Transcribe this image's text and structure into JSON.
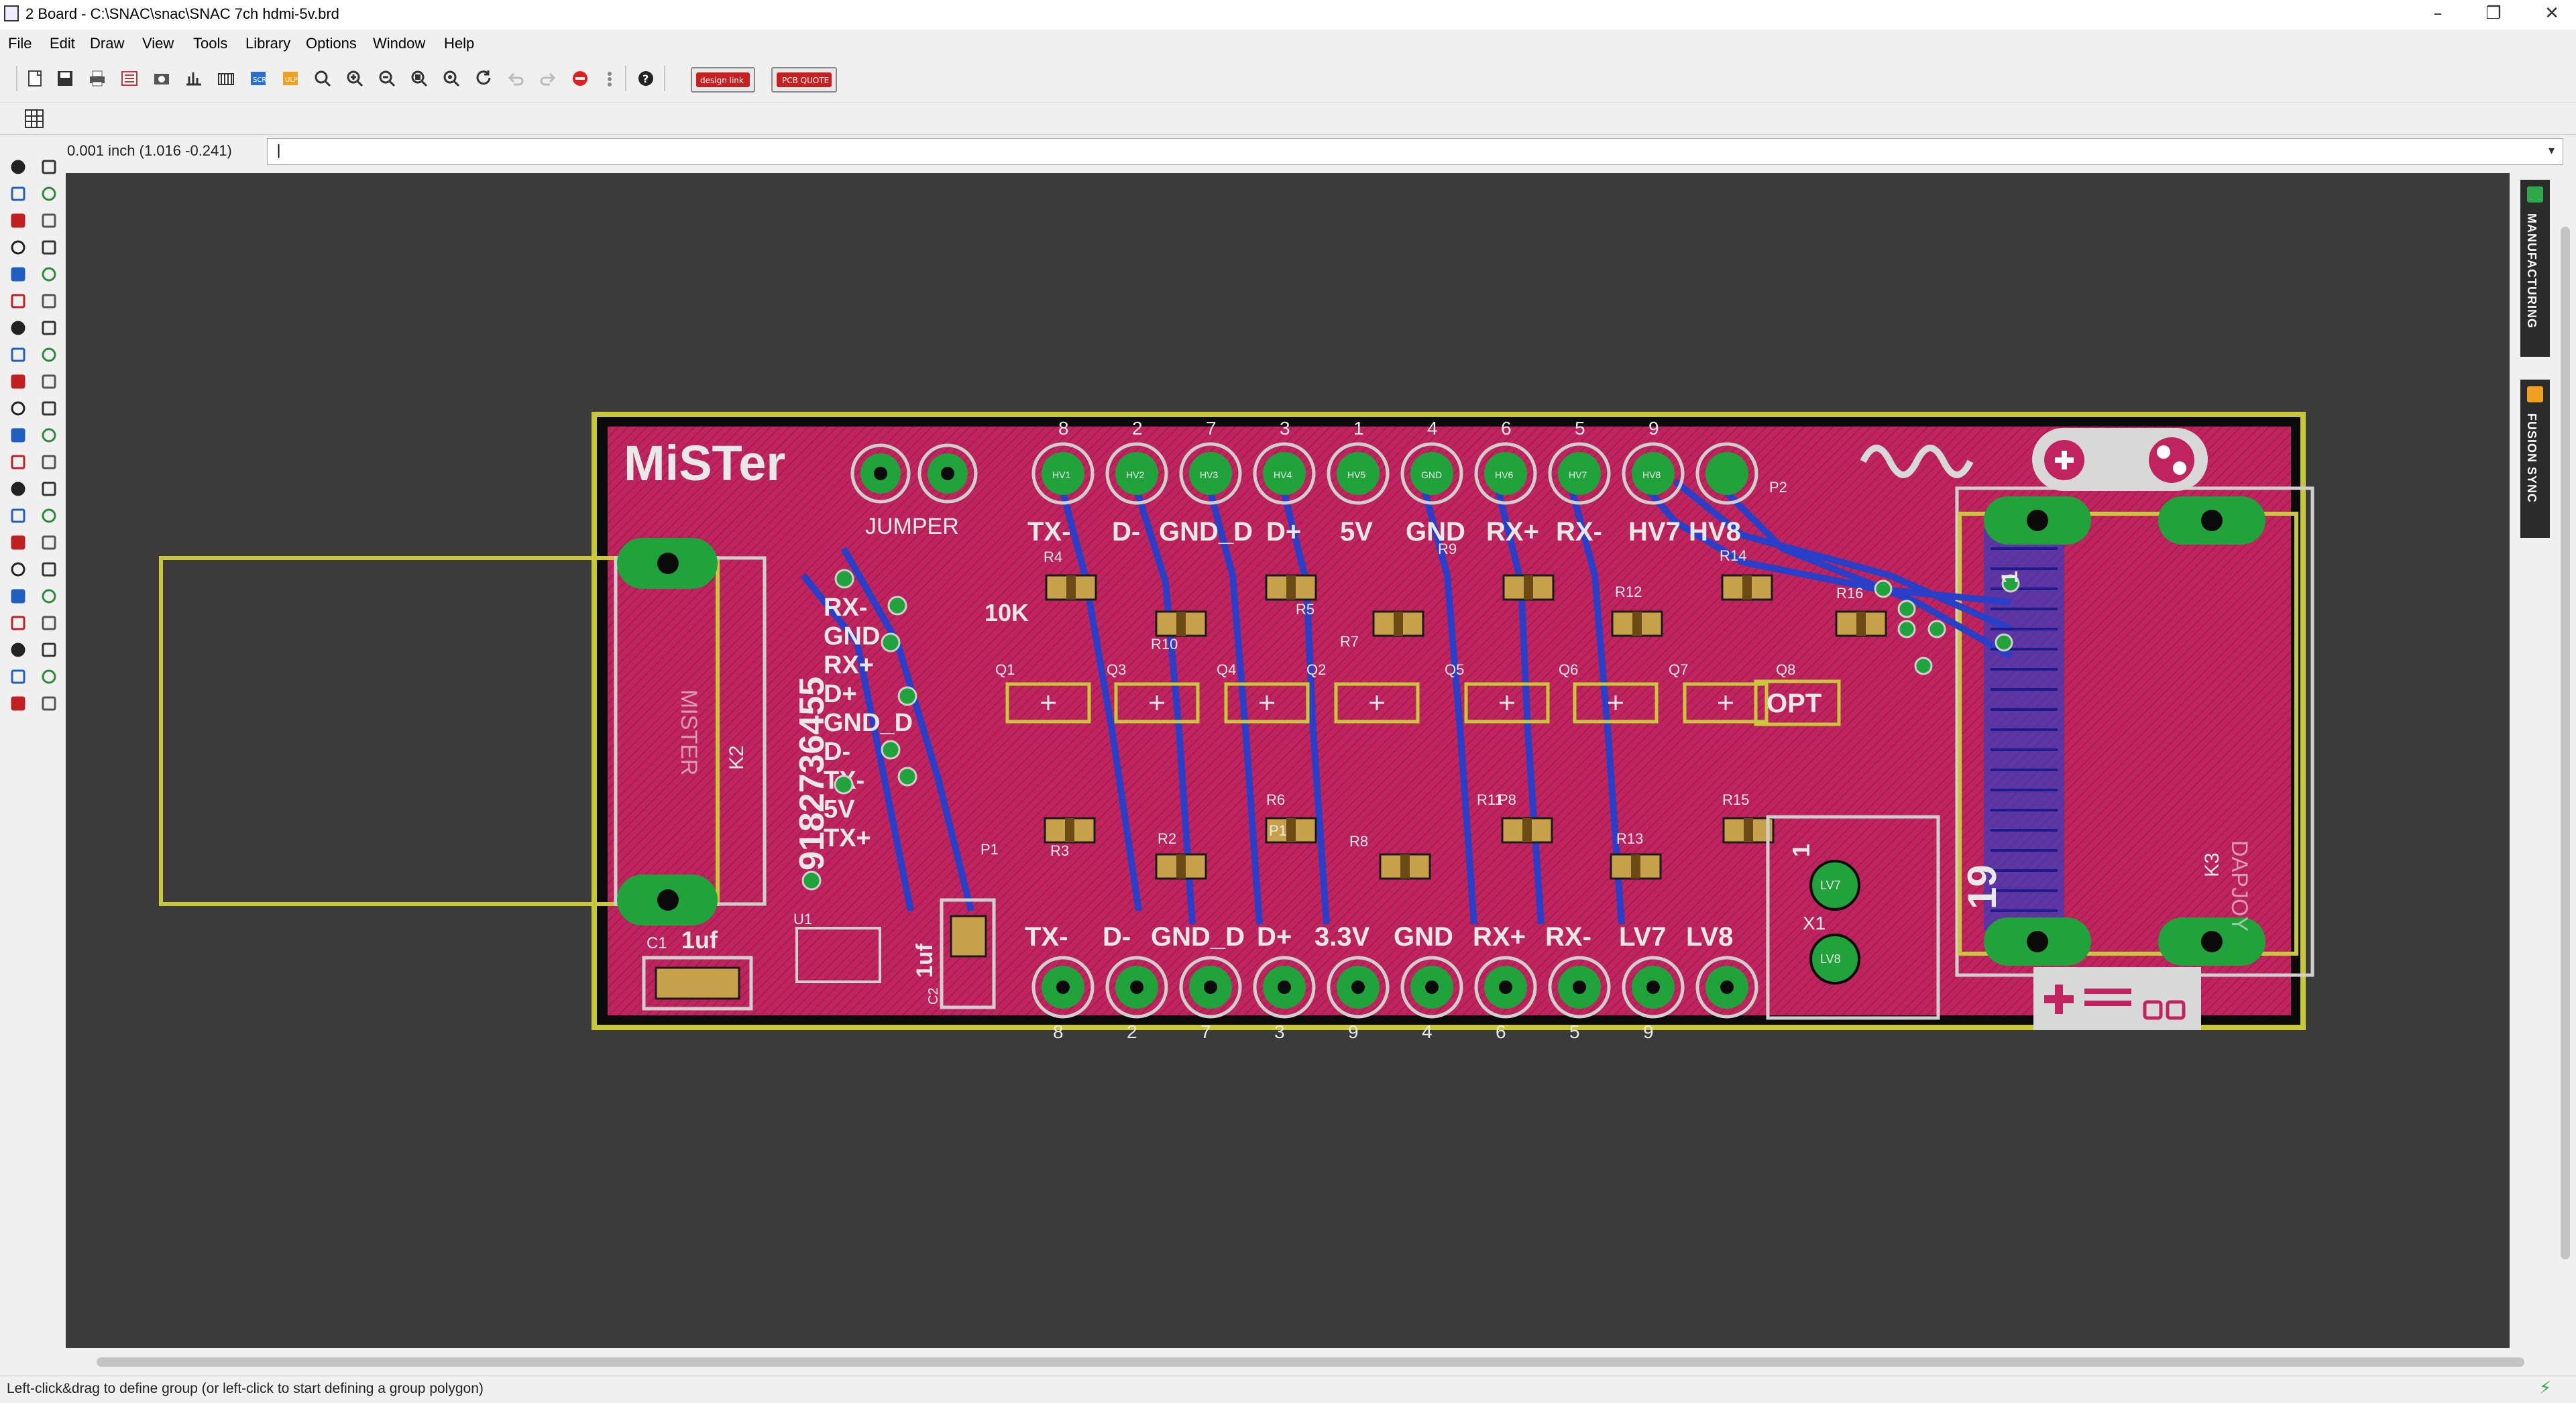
{
  "window": {
    "title": "2 Board - C:\\SNAC\\snac\\SNAC  7ch hdmi-5v.brd",
    "controls": [
      "minimize",
      "restore",
      "close"
    ]
  },
  "menu": {
    "items": [
      "File",
      "Edit",
      "Draw",
      "View",
      "Tools",
      "Library",
      "Options",
      "Window",
      "Help"
    ]
  },
  "toolbar": {
    "buttons": [
      "new-icon",
      "save-icon",
      "print-icon",
      "cam-icon",
      "board-icon",
      "schematic-icon",
      "layer-icon",
      "script-icon",
      "zoom-fit-icon",
      "zoom-in-icon",
      "zoom-out-icon",
      "zoom-select-icon",
      "zoom-last-icon",
      "redraw-icon",
      "undo-icon",
      "redo-icon",
      "stop-icon",
      "go-icon",
      "help-icon"
    ],
    "design_link_label": "design link",
    "pcb_quote_label": "PCB QUOTE"
  },
  "command": {
    "coordinate_readout": "0.001 inch (1.016 -0.241)",
    "input_value": "|"
  },
  "side_panels": {
    "manufacturing": "MANUFACTURING",
    "fusion_sync": "FUSION SYNC"
  },
  "status": {
    "hint": "Left-click&drag to define group (or left-click to start defining a group polygon)"
  },
  "colors": {
    "canvas_bg": "#3b3b3b",
    "board_fill": "#c0245e",
    "board_outline": "#c8c83a",
    "bottom_traces": "#2a3fc8",
    "pad_green": "#1fa33a",
    "silk": "#e8e8e8",
    "smd_pad": "#c8a24a"
  },
  "board": {
    "logo": "MiSTer",
    "jumper_label": "JUMPER",
    "header_pin_numbers": [
      "8",
      "2",
      "7",
      "3",
      "1",
      "4",
      "6",
      "5",
      "9"
    ],
    "top_signals": [
      "TX-",
      "D-",
      "GND_D",
      "D+",
      "5V",
      "GND",
      "RX+",
      "RX-",
      "HV7",
      "HV8"
    ],
    "pad_labels_top": [
      "HV1",
      "HV2",
      "HV3",
      "HV4",
      "HV5",
      "GND",
      "HV6",
      "HV7",
      "HV8"
    ],
    "bottom_signals": [
      "TX-",
      "D-",
      "GND_D",
      "D+",
      "3.3V",
      "GND",
      "RX+",
      "RX-",
      "LV7",
      "LV8"
    ],
    "bottom_pin_numbers": [
      "8",
      "2",
      "7",
      "3",
      "9",
      "4",
      "6",
      "5",
      "9"
    ],
    "left_connector_signals": [
      "RX-",
      "GND",
      "RX+",
      "D+",
      "GND_D",
      "D-",
      "TX-",
      "5V",
      "TX+"
    ],
    "left_part_number": "9182736455",
    "connector_left_ref": "K2",
    "connector_left_name": "MISTER",
    "connector_right_ref": "K3",
    "connector_right_name": "DAPJOY",
    "resistor_refs_top": [
      "R4",
      "R10",
      "R5",
      "R7",
      "R9",
      "R12",
      "R14",
      "R16"
    ],
    "resistor_refs_bottom": [
      "R3",
      "R2",
      "R6",
      "R8",
      "R11",
      "R13",
      "R15"
    ],
    "transistor_refs": [
      "Q1",
      "Q3",
      "Q4",
      "Q2",
      "Q5",
      "Q6",
      "Q7",
      "Q8"
    ],
    "pot_refs": [
      "P1",
      "P1",
      "P8"
    ],
    "value_10k": "10K",
    "opt_label": "OPT",
    "cap_c1": "C1",
    "cap_c1_value": "1uf",
    "cap_c2": "C2",
    "cap_c2_value": "1uf",
    "u1": "U1",
    "x1": "X1",
    "lv7": "LV7",
    "lv8": "LV8",
    "pin19": "19",
    "pin1": "1",
    "p2": "P2"
  }
}
